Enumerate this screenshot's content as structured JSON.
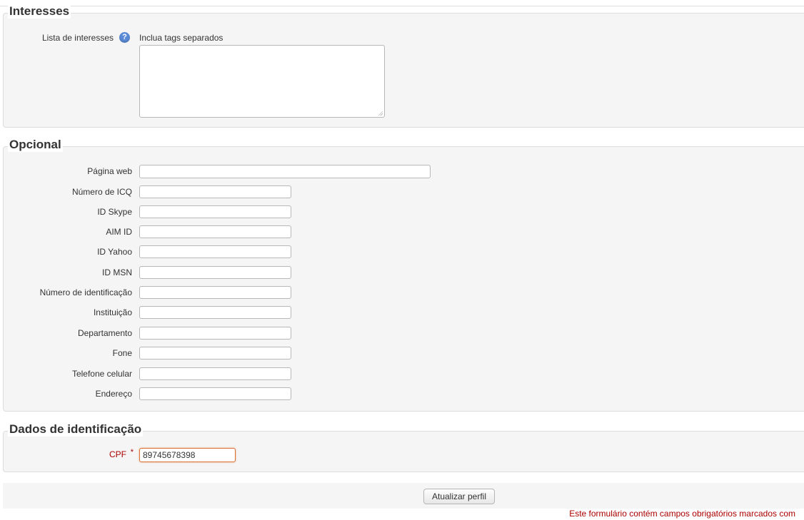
{
  "colors": {
    "panel_bg": "#f5f5f5",
    "border": "#dddddd",
    "required": "#aa0000",
    "help": "#5a8bd6",
    "focus_border": "#d9733a"
  },
  "interesses": {
    "legend": "Interesses",
    "label": "Lista de interesses",
    "help_icon": "help-icon",
    "hint": "Inclua tags separados"
  },
  "opcional": {
    "legend": "Opcional",
    "fields": [
      {
        "label": "Página web",
        "value": ""
      },
      {
        "label": "Número de ICQ",
        "value": ""
      },
      {
        "label": "ID Skype",
        "value": ""
      },
      {
        "label": "AIM ID",
        "value": ""
      },
      {
        "label": "ID Yahoo",
        "value": ""
      },
      {
        "label": "ID MSN",
        "value": ""
      },
      {
        "label": "Número de identificação",
        "value": ""
      },
      {
        "label": "Instituição",
        "value": ""
      },
      {
        "label": "Departamento",
        "value": ""
      },
      {
        "label": "Fone",
        "value": ""
      },
      {
        "label": "Telefone celular",
        "value": ""
      },
      {
        "label": "Endereço",
        "value": ""
      }
    ]
  },
  "identificacao": {
    "legend": "Dados de identificação",
    "cpf_label": "CPF",
    "required_mark": "*",
    "cpf_value": "89745678398"
  },
  "actions": {
    "submit_label": "Atualizar perfil",
    "required_note": "Este formulário contém campos obrigatórios marcados com"
  }
}
